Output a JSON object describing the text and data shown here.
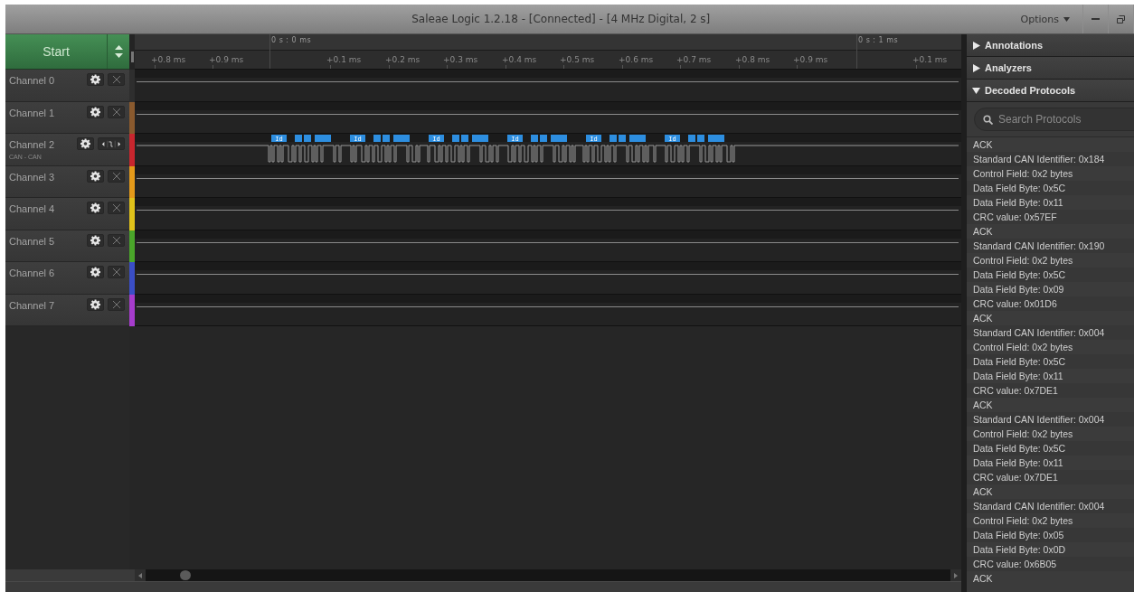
{
  "window": {
    "title": "Saleae Logic 1.2.18 - [Connected] - [4 MHz Digital, 2 s]",
    "options_menu": "Options"
  },
  "start_button": {
    "label": "Start"
  },
  "ruler": {
    "markers": [
      "0 s : 0 ms",
      "0 s : 1 ms"
    ],
    "ticks": [
      "+0.8 ms",
      "+0.9 ms",
      "+0.1 ms",
      "+0.2 ms",
      "+0.3 ms",
      "+0.4 ms",
      "+0.5 ms",
      "+0.6 ms",
      "+0.7 ms",
      "+0.8 ms",
      "+0.9 ms",
      "+0.1 ms"
    ]
  },
  "channels": [
    {
      "name": "Channel 0",
      "color": "#2e2e2e",
      "kind": "plain"
    },
    {
      "name": "Channel 1",
      "color": "#8a5a2e",
      "kind": "plain"
    },
    {
      "name": "Channel 2",
      "subtitle": "CAN - CAN",
      "color": "#c8262e",
      "kind": "analyzed",
      "frames": [
        {
          "label": "Id"
        },
        {
          "label": "Id"
        },
        {
          "label": "Id"
        },
        {
          "label": "Id"
        },
        {
          "label": "Id"
        },
        {
          "label": "Id"
        }
      ]
    },
    {
      "name": "Channel 3",
      "color": "#e49a1a",
      "kind": "plain"
    },
    {
      "name": "Channel 4",
      "color": "#e0c21a",
      "kind": "plain"
    },
    {
      "name": "Channel 5",
      "color": "#4aa62a",
      "kind": "plain"
    },
    {
      "name": "Channel 6",
      "color": "#3a4ec6",
      "kind": "plain"
    },
    {
      "name": "Channel 7",
      "color": "#a63ccc",
      "kind": "plain"
    }
  ],
  "side_panel": {
    "sections": [
      {
        "title": "Annotations",
        "expanded": false
      },
      {
        "title": "Analyzers",
        "expanded": false
      },
      {
        "title": "Decoded Protocols",
        "expanded": true
      }
    ],
    "search": {
      "placeholder": "Search Protocols"
    },
    "results": [
      "ACK",
      "Standard CAN Identifier: 0x184",
      "Control Field: 0x2 bytes",
      "Data Field Byte: 0x5C",
      "Data Field Byte: 0x11",
      "CRC value: 0x57EF",
      "ACK",
      "Standard CAN Identifier: 0x190",
      "Control Field: 0x2 bytes",
      "Data Field Byte: 0x5C",
      "Data Field Byte: 0x09",
      "CRC value: 0x01D6",
      "ACK",
      "Standard CAN Identifier: 0x004",
      "Control Field: 0x2 bytes",
      "Data Field Byte: 0x5C",
      "Data Field Byte: 0x11",
      "CRC value: 0x7DE1",
      "ACK",
      "Standard CAN Identifier: 0x004",
      "Control Field: 0x2 bytes",
      "Data Field Byte: 0x5C",
      "Data Field Byte: 0x11",
      "CRC value: 0x7DE1",
      "ACK",
      "Standard CAN Identifier: 0x004",
      "Control Field: 0x2 bytes",
      "Data Field Byte: 0x05",
      "Data Field Byte: 0x0D",
      "CRC value: 0x6B05",
      "ACK"
    ]
  }
}
